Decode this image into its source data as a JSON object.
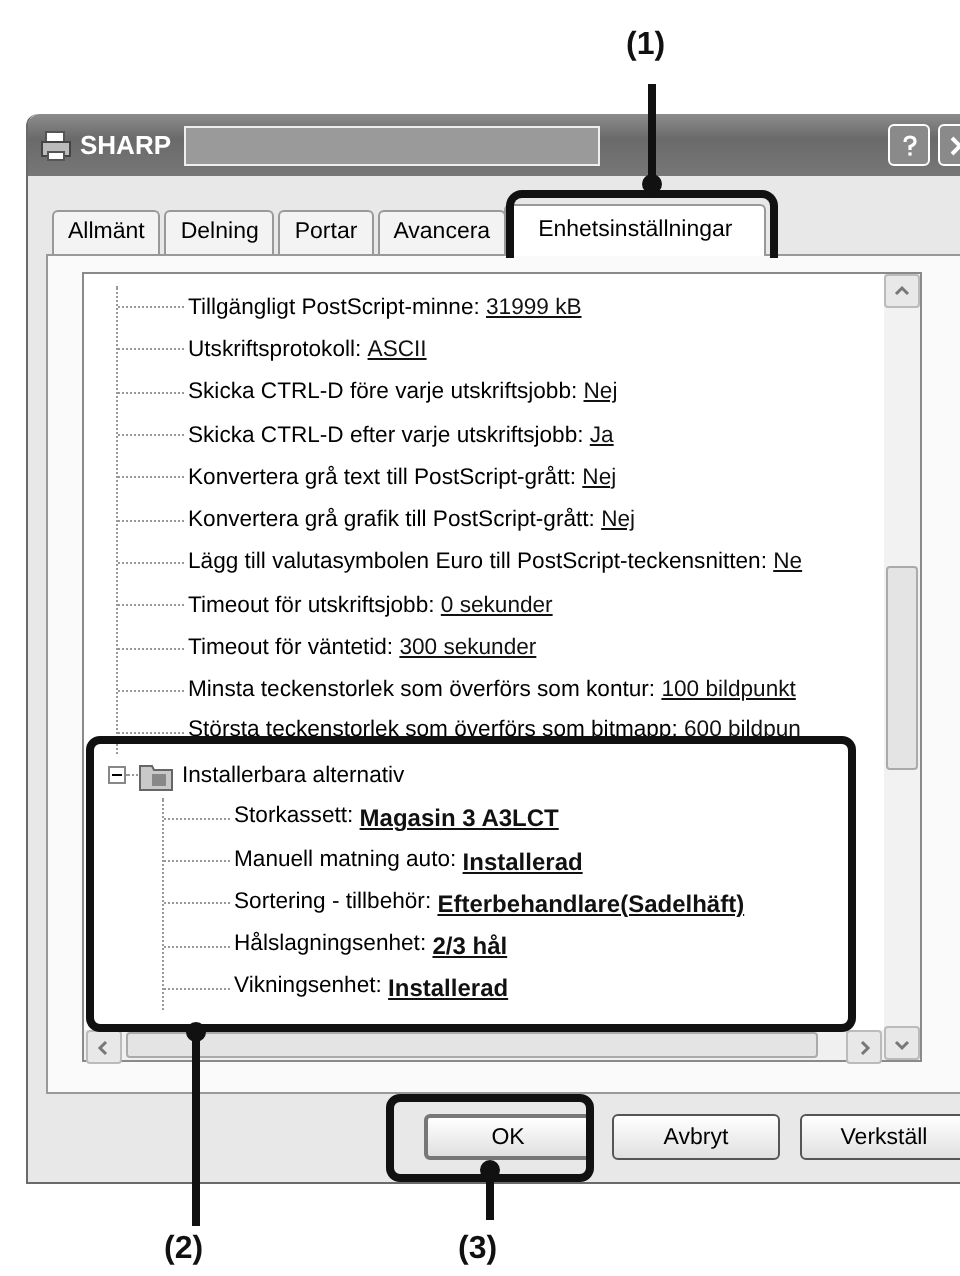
{
  "callouts": [
    {
      "label": "(1)"
    },
    {
      "label": "(2)"
    },
    {
      "label": "(3)"
    }
  ],
  "window": {
    "title": "SHARP"
  },
  "tabs": [
    {
      "label": "Allmänt",
      "selected": false
    },
    {
      "label": "Delning",
      "selected": false
    },
    {
      "label": "Portar",
      "selected": false
    },
    {
      "label": "Avancera",
      "selected": false
    },
    {
      "label": "Enhetsinställningar",
      "selected": true
    }
  ],
  "tree": {
    "items": [
      {
        "label": "Tillgängligt PostScript-minne:",
        "value": "31999 kB"
      },
      {
        "label": "Utskriftsprotokoll:",
        "value": "ASCII"
      },
      {
        "label": "Skicka CTRL-D före varje utskriftsjobb:",
        "value": "Nej"
      },
      {
        "label": "Skicka CTRL-D efter varje utskriftsjobb:",
        "value": "Ja"
      },
      {
        "label": "Konvertera grå text till PostScript-grått:",
        "value": "Nej"
      },
      {
        "label": "Konvertera grå grafik till PostScript-grått:",
        "value": "Nej"
      },
      {
        "label": "Lägg till valutasymbolen Euro till PostScript-teckensnitten:",
        "value": "Ne"
      },
      {
        "label": "Timeout för utskriftsjobb:",
        "value": "0 sekunder"
      },
      {
        "label": "Timeout för väntetid:",
        "value": "300 sekunder"
      },
      {
        "label": "Minsta teckenstorlek som överförs som kontur:",
        "value": "100 bildpunkt"
      },
      {
        "label": "Största teckenstorlek som överförs som bitmapp:",
        "value": "600 bildpun",
        "covered": true
      }
    ],
    "group": {
      "label": "Installerbara alternativ",
      "expanded": true,
      "children": [
        {
          "label": "Storkassett:",
          "value": "Magasin 3  A3LCT"
        },
        {
          "label": "Manuell matning auto:",
          "value": "Installerad"
        },
        {
          "label": "Sortering - tillbehör:",
          "value": "Efterbehandlare(Sadelhäft)"
        },
        {
          "label": "Hålslagningsenhet:",
          "value": "2/3 hål"
        },
        {
          "label": "Vikningsenhet:",
          "value": "Installerad"
        }
      ]
    }
  },
  "buttons": [
    {
      "label": "OK",
      "default": true
    },
    {
      "label": "Avbryt",
      "default": false
    },
    {
      "label": "Verkställ",
      "default": false
    }
  ]
}
